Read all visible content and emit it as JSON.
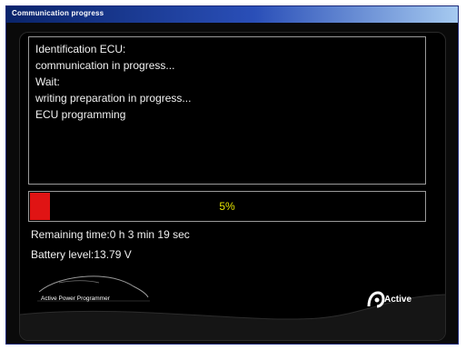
{
  "window": {
    "title": "Communication progress"
  },
  "messages": [
    "Identification ECU:",
    "communication in progress...",
    "Wait:",
    "writing preparation in progress...",
    "ECU programming"
  ],
  "progress": {
    "percent": 5,
    "label": "5%",
    "fill_color": "#e01414",
    "text_color": "#e6e600"
  },
  "status": {
    "remaining_time": "Remaining time:0 h 3 min 19 sec",
    "battery_level": "Battery level:13.79 V"
  },
  "logos": {
    "car_logo_text": "Active Power Programmer",
    "brand_text": "Active"
  }
}
